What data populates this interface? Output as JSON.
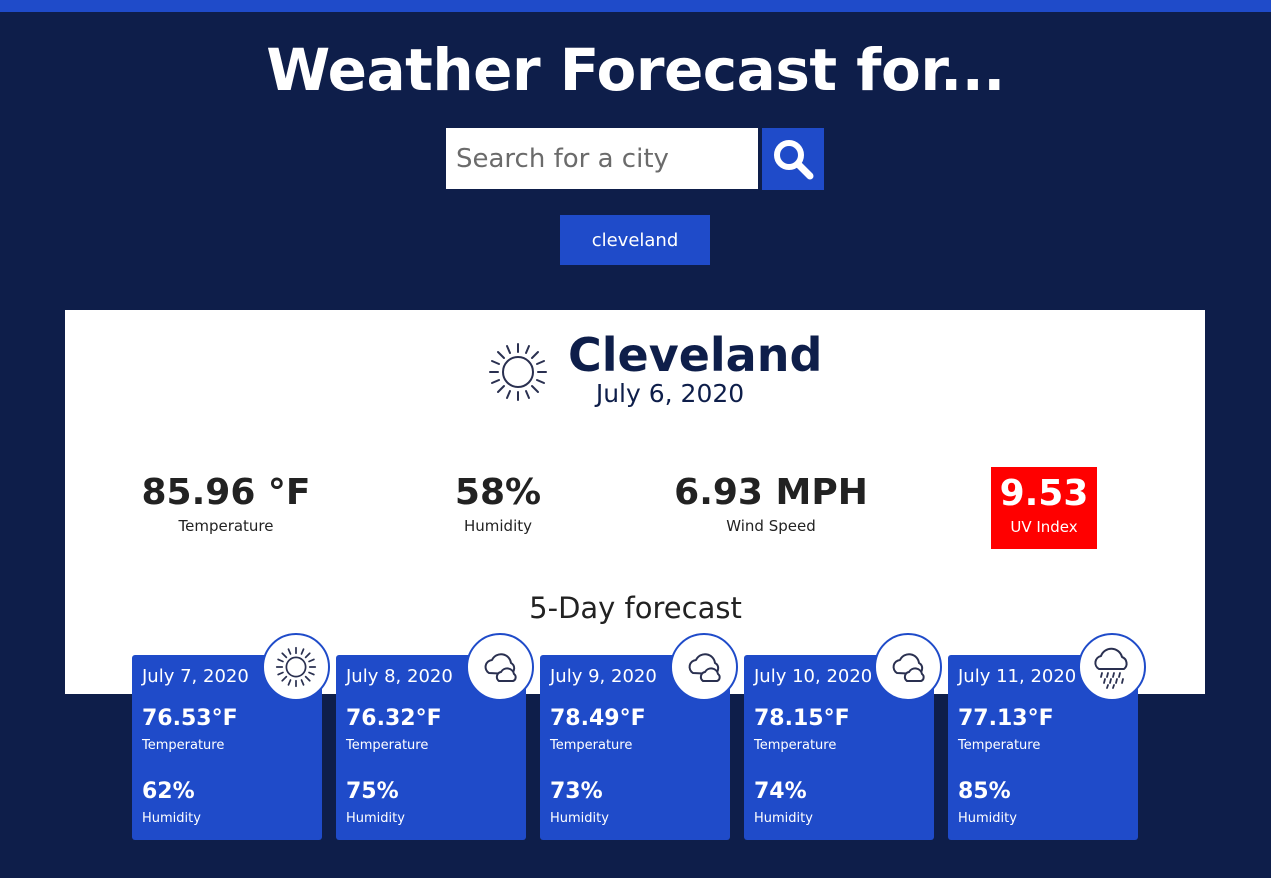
{
  "header": {
    "title": "Weather Forecast for..."
  },
  "search": {
    "placeholder": "Search for a city",
    "value": "",
    "button_icon": "search-icon"
  },
  "history": {
    "items": [
      "cleveland"
    ]
  },
  "current": {
    "icon": "sun-icon",
    "city": "Cleveland",
    "date": "July 6, 2020",
    "temperature": {
      "value": "85.96 °F",
      "label": "Temperature"
    },
    "humidity": {
      "value": "58%",
      "label": "Humidity"
    },
    "wind": {
      "value": "6.93 MPH",
      "label": "Wind Speed"
    },
    "uv": {
      "value": "9.53",
      "label": "UV Index",
      "color": "#ff0000"
    }
  },
  "forecast": {
    "heading": "5-Day forecast",
    "days": [
      {
        "date": "July 7, 2020",
        "icon": "sun-icon",
        "temp": "76.53°F",
        "temp_label": "Temperature",
        "humidity": "62%",
        "humidity_label": "Humidity"
      },
      {
        "date": "July 8, 2020",
        "icon": "cloud-icon",
        "temp": "76.32°F",
        "temp_label": "Temperature",
        "humidity": "75%",
        "humidity_label": "Humidity"
      },
      {
        "date": "July 9, 2020",
        "icon": "cloud-icon",
        "temp": "78.49°F",
        "temp_label": "Temperature",
        "humidity": "73%",
        "humidity_label": "Humidity"
      },
      {
        "date": "July 10, 2020",
        "icon": "cloud-icon",
        "temp": "78.15°F",
        "temp_label": "Temperature",
        "humidity": "74%",
        "humidity_label": "Humidity"
      },
      {
        "date": "July 11, 2020",
        "icon": "rain-icon",
        "temp": "77.13°F",
        "temp_label": "Temperature",
        "humidity": "85%",
        "humidity_label": "Humidity"
      }
    ]
  },
  "colors": {
    "background": "#0e1e4a",
    "accent": "#1f4bc9",
    "panel": "#ffffff",
    "uv_high": "#ff0000"
  }
}
